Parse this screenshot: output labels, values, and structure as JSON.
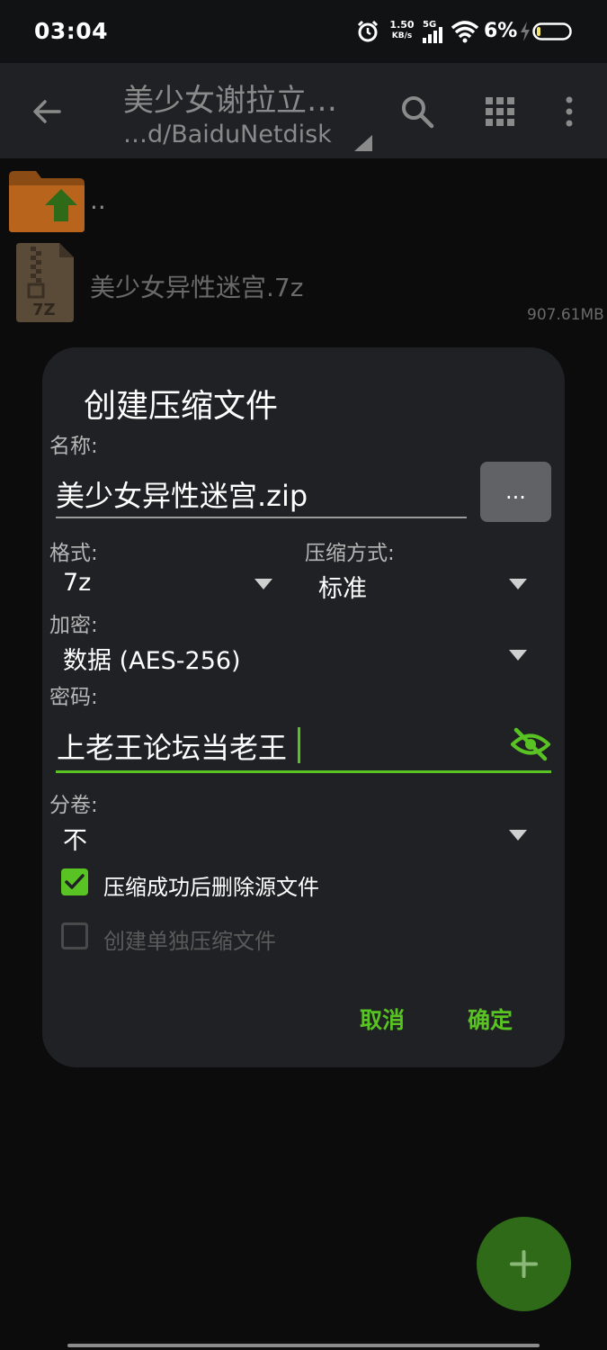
{
  "status_bar": {
    "time": "03:04",
    "net_speed_value": "1.50",
    "net_speed_unit": "KB/s",
    "network": "5G",
    "battery": "6%",
    "icons": [
      "alarm-icon",
      "signal-icon",
      "wifi-icon",
      "charging-icon",
      "battery-icon"
    ]
  },
  "app_bar": {
    "title": "美少女谢拉立…",
    "subtitle": "…d/BaiduNetdisk",
    "icons": [
      "back-arrow-icon",
      "search-icon",
      "grid-view-icon",
      "more-vert-icon"
    ]
  },
  "file_list": {
    "parent_label": "..",
    "items": [
      {
        "name": "美少女异性迷宫.7z",
        "size": "907.61MB",
        "badge": "7Z"
      }
    ]
  },
  "dialog": {
    "title": "创建压缩文件",
    "name_label": "名称:",
    "name_value": "美少女异性迷宫.zip",
    "browse_label": "...",
    "format_label": "格式:",
    "format_value": "7z",
    "method_label": "压缩方式:",
    "method_value": "标准",
    "encryption_label": "加密:",
    "encryption_value": "数据 (AES-256)",
    "password_label": "密码:",
    "password_value": "上老王论坛当老王",
    "volume_label": "分卷:",
    "volume_value": "不",
    "delete_source_label": "压缩成功后删除源文件",
    "delete_source_checked": true,
    "separate_label": "创建单独压缩文件",
    "separate_checked": false,
    "cancel_label": "取消",
    "ok_label": "确定"
  },
  "colors": {
    "accent": "#58c322",
    "dialog_bg": "#202124",
    "app_bar_bg": "#202124",
    "folder": "#c66a1f"
  }
}
